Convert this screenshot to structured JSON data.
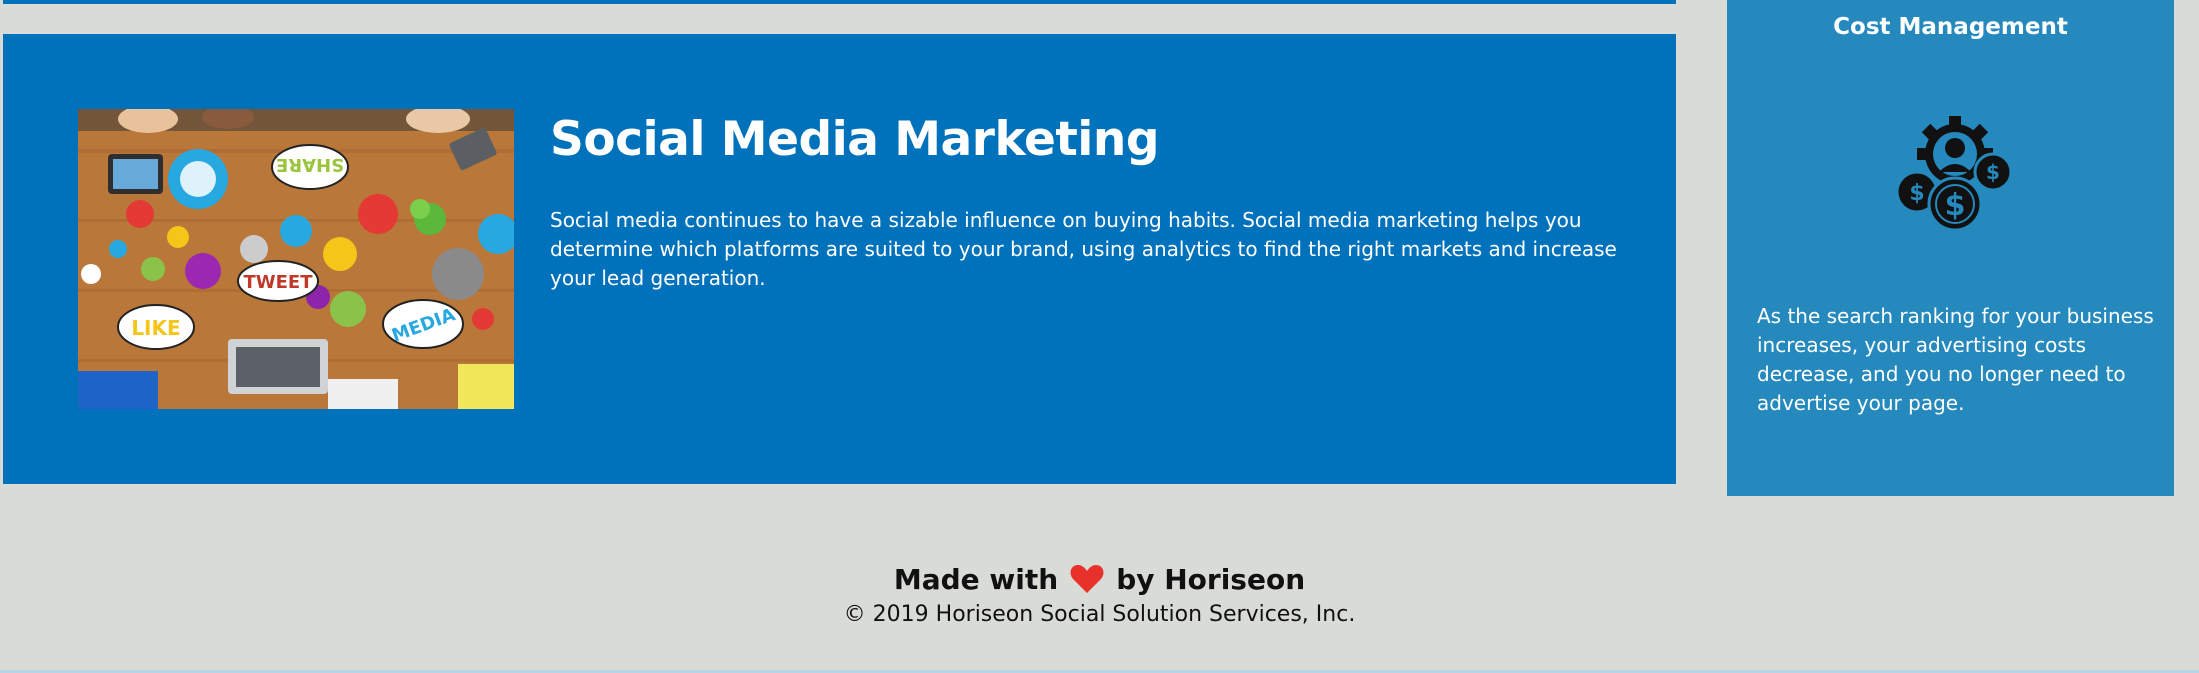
{
  "section": {
    "title": "Social Media Marketing",
    "text": "Social media continues to have a sizable influence on buying habits. Social media marketing helps you determine which platforms are suited to your brand, using analytics to find the right markets and increase your lead generation.",
    "image_labels": {
      "share": "SHARE",
      "tweet": "TWEET",
      "like": "LIKE",
      "media": "MEDIA"
    }
  },
  "benefit": {
    "title": "Cost Management",
    "text": "As the search ranking for your business increases, your advertising costs decrease, and you no longer need to advertise your page.",
    "icon": "cost-management-icon"
  },
  "footer": {
    "made_prefix": "Made with",
    "made_suffix": "by Horiseon",
    "heart_icon": "heart-icon",
    "copyright": "© 2019 Horiseon Social Solution Services, Inc."
  },
  "colors": {
    "page_bg": "#d9dcd6",
    "card_bg": "#0072bb",
    "benefit_bg": "#2589bd",
    "heart": "#e8312a"
  }
}
